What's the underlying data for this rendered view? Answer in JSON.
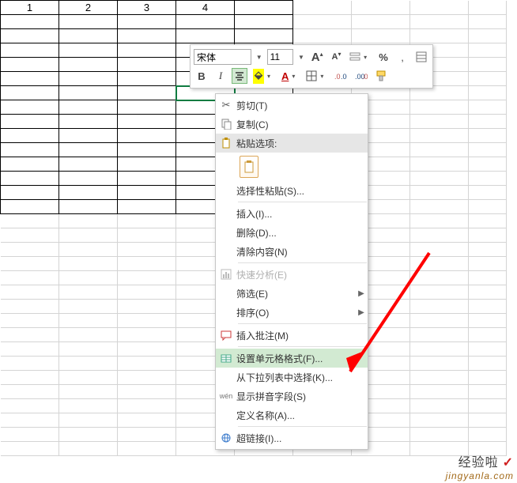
{
  "grid": {
    "header_values": [
      "1",
      "2",
      "3",
      "4"
    ],
    "bordered_rows_after_header": 14,
    "total_rows": 32,
    "total_cols": 9
  },
  "mini_toolbar": {
    "font_name": "宋体",
    "font_size": "11",
    "bold": "B",
    "italic": "I",
    "percent": "%",
    "thousand": ",",
    "increaseA": "A",
    "decreaseA": "A",
    "underlineA": "A"
  },
  "context_menu": {
    "cut": "剪切(T)",
    "copy": "复制(C)",
    "paste_options": "粘贴选项:",
    "paste_special": "选择性粘贴(S)...",
    "insert": "插入(I)...",
    "delete": "删除(D)...",
    "clear": "清除内容(N)",
    "quick_analysis": "快速分析(E)",
    "filter": "筛选(E)",
    "sort": "排序(O)",
    "insert_comment": "插入批注(M)",
    "format_cells": "设置单元格格式(F)...",
    "pick_from_list": "从下拉列表中选择(K)...",
    "show_pinyin": "显示拼音字段(S)",
    "define_name": "定义名称(A)...",
    "hyperlink": "超链接(I)..."
  },
  "watermark": {
    "line1": "经验啦",
    "line2": "jingyanla.com"
  }
}
